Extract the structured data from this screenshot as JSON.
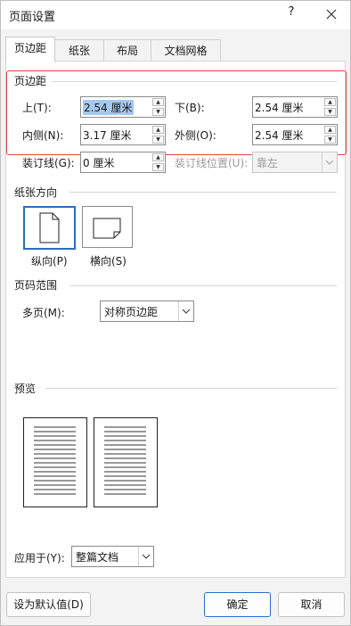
{
  "window": {
    "title": "页面设置",
    "help_label": "?"
  },
  "tabs": [
    {
      "label": "页边距",
      "active": true
    },
    {
      "label": "纸张"
    },
    {
      "label": "布局"
    },
    {
      "label": "文档网格"
    }
  ],
  "margins": {
    "section_title": "页边距",
    "top_label": "上(T):",
    "top_value": "2.54 厘米",
    "bottom_label": "下(B):",
    "bottom_value": "2.54 厘米",
    "inside_label": "内侧(N):",
    "inside_value": "3.17 厘米",
    "outside_label": "外侧(O):",
    "outside_value": "2.54 厘米",
    "gutter_label": "装订线(G):",
    "gutter_value": "0 厘米",
    "gutter_pos_label": "装订线位置(U):",
    "gutter_pos_value": "靠左"
  },
  "orientation": {
    "section_title": "纸张方向",
    "portrait_label": "纵向(P)",
    "landscape_label": "横向(S)"
  },
  "pages": {
    "section_title": "页码范围",
    "multiple_label": "多页(M):",
    "multiple_value": "对称页边距"
  },
  "preview": {
    "section_title": "预览"
  },
  "apply": {
    "label": "应用于(Y):",
    "value": "整篇文档"
  },
  "buttons": {
    "default": "设为默认值(D)",
    "ok": "确定",
    "cancel": "取消"
  },
  "colors": {
    "highlight_border": "#e0453f",
    "selected_blue": "#2a6ebb",
    "selection_bg": "#a5c8ef"
  }
}
